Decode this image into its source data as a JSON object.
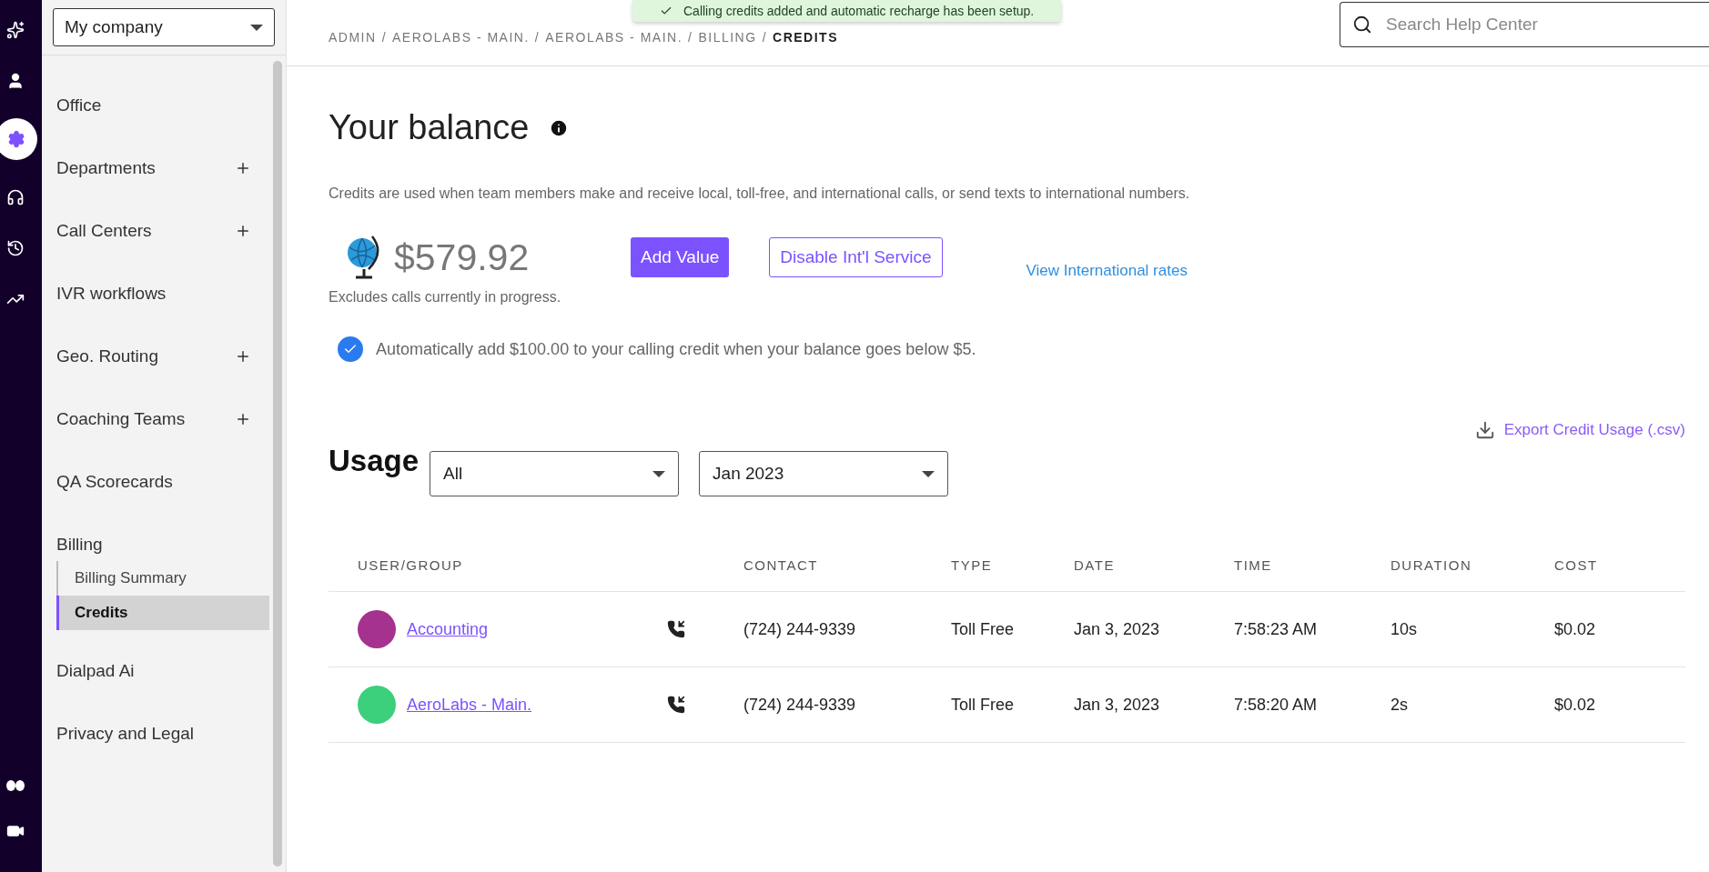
{
  "rail": [
    {
      "kind": "sparkle",
      "selected": false
    },
    {
      "kind": "person",
      "selected": false
    },
    {
      "kind": "gear",
      "selected": true
    },
    {
      "kind": "headset",
      "selected": false
    },
    {
      "kind": "history",
      "selected": false
    },
    {
      "kind": "trend",
      "selected": false
    }
  ],
  "rail_bottom": [
    {
      "kind": "logo"
    },
    {
      "kind": "video"
    }
  ],
  "company_select": {
    "value": "My company"
  },
  "breadcrumb": {
    "separator": "/",
    "items": [
      "ADMIN",
      "AEROLABS - MAIN.",
      "AEROLABS - MAIN.",
      "BILLING",
      "CREDITS"
    ]
  },
  "toast": {
    "message": "Calling credits added and automatic recharge has been setup."
  },
  "search": {
    "placeholder": "Search Help Center"
  },
  "sidebar": {
    "items": [
      {
        "label": "Office",
        "expandable": false
      },
      {
        "label": "Departments",
        "expandable": true
      },
      {
        "label": "Call Centers",
        "expandable": true
      },
      {
        "label": "IVR workflows",
        "expandable": false
      },
      {
        "label": "Geo. Routing",
        "expandable": true
      },
      {
        "label": "Coaching Teams",
        "expandable": true
      },
      {
        "label": "QA Scorecards",
        "expandable": false
      },
      {
        "label": "Billing",
        "expandable": false,
        "expanded": true,
        "children": [
          {
            "label": "Billing Summary",
            "selected": false
          },
          {
            "label": "Credits",
            "selected": true
          }
        ]
      },
      {
        "label": "Dialpad Ai",
        "expandable": false
      },
      {
        "label": "Privacy and Legal",
        "expandable": false
      }
    ]
  },
  "balance": {
    "title": "Your balance",
    "description": "Credits are used when team members make and receive local, toll-free, and international calls, or send texts to international numbers.",
    "amount": "$579.92",
    "add_button": "Add Value",
    "disable_button": "Disable Int'l Service",
    "rates_link": "View International rates",
    "note": "Excludes calls currently in progress.",
    "auto_recharge": {
      "label": "Automatically add $100.00 to your calling credit when your balance goes below $5.",
      "checked": true
    }
  },
  "usage": {
    "title": "Usage",
    "export_link": "Export Credit Usage (.csv)",
    "filter": "All",
    "month": "Jan 2023",
    "columns": [
      "USER/GROUP",
      "CONTACT",
      "TYPE",
      "DATE",
      "TIME",
      "DURATION",
      "COST"
    ],
    "rows": [
      {
        "user": "Accounting",
        "color": "#a5328f",
        "contact": "(724) 244-9339",
        "type": "Toll Free",
        "date": "Jan 3, 2023",
        "time": "7:58:23 AM",
        "duration": "10s",
        "cost": "$0.02"
      },
      {
        "user": "AeroLabs - Main.",
        "color": "#3ccf7c",
        "contact": "(724) 244-9339",
        "type": "Toll Free",
        "date": "Jan 3, 2023",
        "time": "7:58:20 AM",
        "duration": "2s",
        "cost": "$0.02"
      }
    ]
  }
}
